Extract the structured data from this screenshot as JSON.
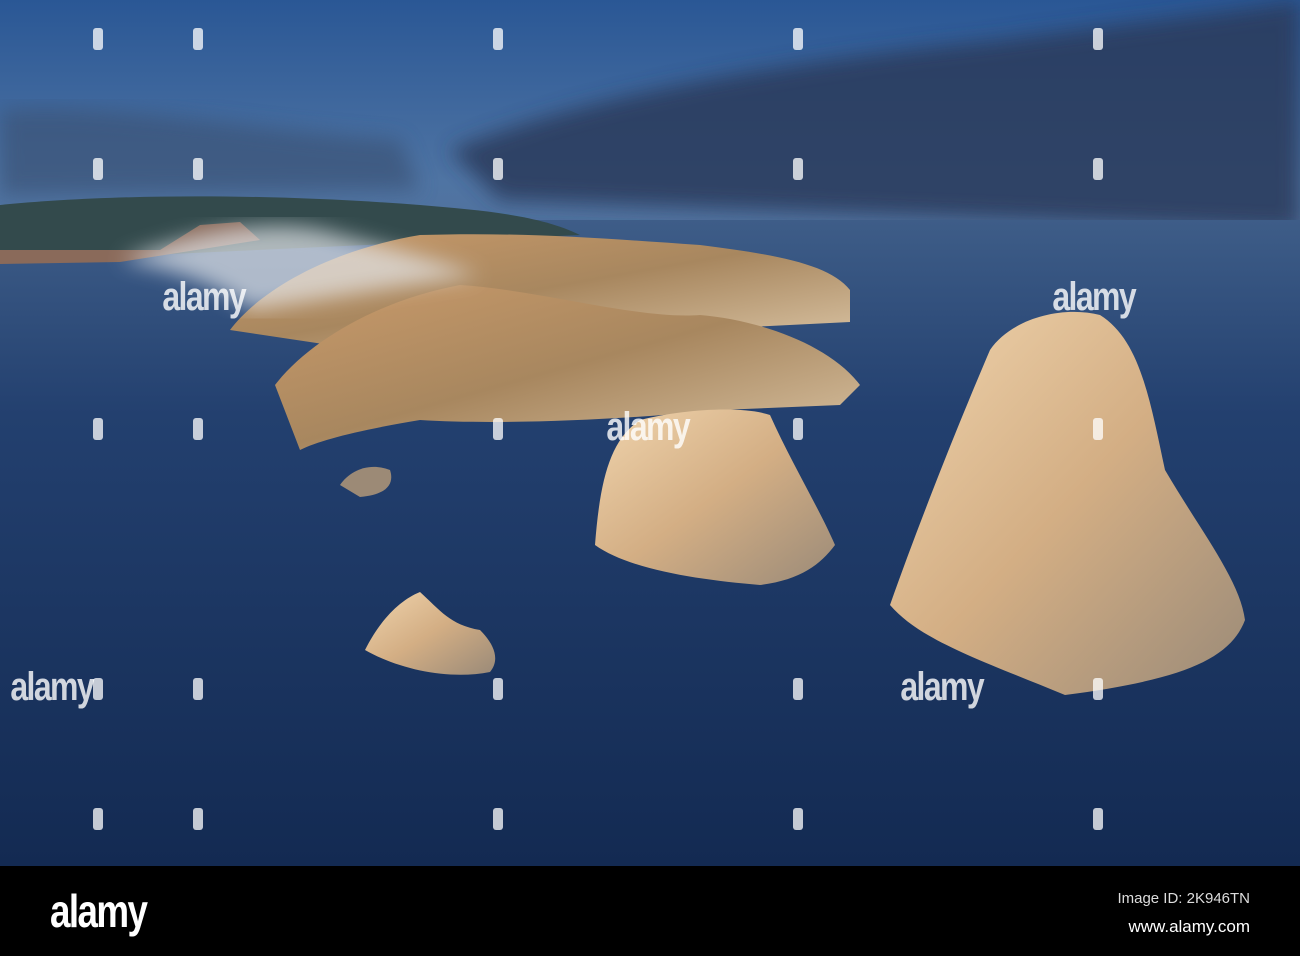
{
  "footer": {
    "logo": "alamy",
    "image_id": "Image ID: 2K946TN",
    "url": "www.alamy.com"
  },
  "watermark": "alamy",
  "colors": {
    "sky_top": "#2a5795",
    "horizon": "#5b7da6",
    "sea": "#1c3766",
    "rock": "#d9b58c"
  }
}
